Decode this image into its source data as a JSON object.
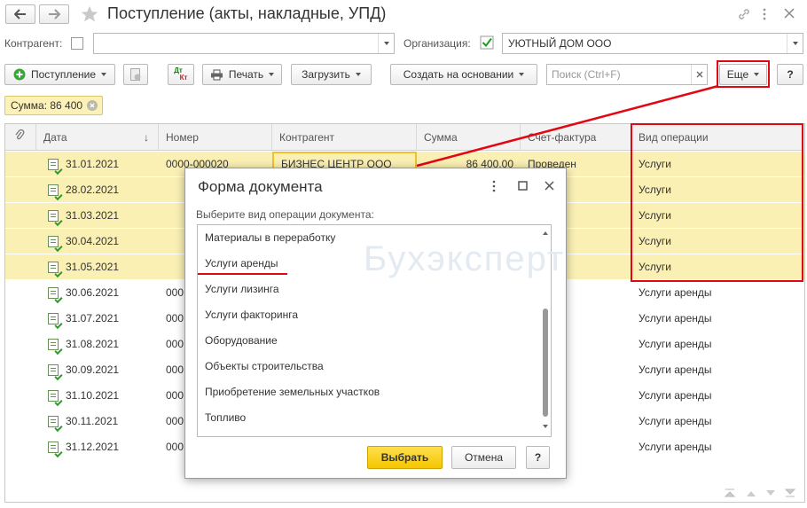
{
  "window": {
    "title": "Поступление (акты, накладные, УПД)"
  },
  "filters": {
    "counterparty_label": "Контрагент:",
    "counterparty_value": "",
    "org_label": "Организация:",
    "org_value": "УЮТНЫЙ ДОМ ООО"
  },
  "toolbar": {
    "receipt": "Поступление",
    "print": "Печать",
    "load": "Загрузить",
    "create_basis": "Создать на основании",
    "search_placeholder": "Поиск (Ctrl+F)",
    "more": "Еще",
    "help": "?",
    "dtkt_top": "Дт",
    "dtkt_bottom": "Кт"
  },
  "sum_badge": "Сумма: 86 400",
  "table": {
    "columns": [
      "Дата",
      "Номер",
      "Контрагент",
      "Сумма",
      "Счет-фактура",
      "Вид операции"
    ],
    "rows": [
      {
        "date": "31.01.2021",
        "number": "0000-000020",
        "counterparty": "БИЗНЕС ЦЕНТР ООО",
        "sum": "86 400,00",
        "invoice": "Проведен",
        "op": "Услуги"
      },
      {
        "date": "28.02.2021",
        "number": "",
        "counterparty": "",
        "sum": "",
        "invoice": "",
        "op": "Услуги"
      },
      {
        "date": "31.03.2021",
        "number": "",
        "counterparty": "",
        "sum": "",
        "invoice": "",
        "op": "Услуги"
      },
      {
        "date": "30.04.2021",
        "number": "",
        "counterparty": "",
        "sum": "",
        "invoice": "",
        "op": "Услуги"
      },
      {
        "date": "31.05.2021",
        "number": "",
        "counterparty": "",
        "sum": "",
        "invoice": "",
        "op": "Услуги"
      },
      {
        "date": "30.06.2021",
        "number": "000",
        "counterparty": "",
        "sum": "",
        "invoice": "",
        "op": "Услуги аренды"
      },
      {
        "date": "31.07.2021",
        "number": "000",
        "counterparty": "",
        "sum": "",
        "invoice": "",
        "op": "Услуги аренды"
      },
      {
        "date": "31.08.2021",
        "number": "000",
        "counterparty": "",
        "sum": "",
        "invoice": "",
        "op": "Услуги аренды"
      },
      {
        "date": "30.09.2021",
        "number": "000",
        "counterparty": "",
        "sum": "",
        "invoice": "",
        "op": "Услуги аренды"
      },
      {
        "date": "31.10.2021",
        "number": "000",
        "counterparty": "",
        "sum": "",
        "invoice": "",
        "op": "Услуги аренды"
      },
      {
        "date": "30.11.2021",
        "number": "000",
        "counterparty": "",
        "sum": "",
        "invoice": "",
        "op": "Услуги аренды"
      },
      {
        "date": "31.12.2021",
        "number": "000",
        "counterparty": "",
        "sum": "",
        "invoice": "",
        "op": "Услуги аренды"
      }
    ]
  },
  "dialog": {
    "title": "Форма документа",
    "prompt": "Выберите вид операции документа:",
    "items": [
      "Материалы в переработку",
      "Услуги аренды",
      "Услуги лизинга",
      "Услуги факторинга",
      "Оборудование",
      "Объекты строительства",
      "Приобретение земельных участков",
      "Топливо"
    ],
    "choose": "Выбрать",
    "cancel": "Отмена",
    "help": "?"
  },
  "watermark": "Бухэксперт",
  "colors": {
    "selection": "#fbf0b4",
    "accent_yellow": "#f7d32a",
    "annotation_red": "#e30613"
  }
}
